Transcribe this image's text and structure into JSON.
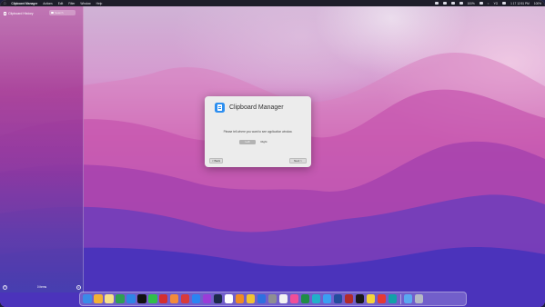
{
  "menubar": {
    "app_name": "Clipboard Manager",
    "items": [
      "Actions",
      "Edit",
      "Filter",
      "Window",
      "Help"
    ],
    "status": {
      "battery": "100%",
      "wifi": "Wi-Fi",
      "lang": "YG",
      "datetime": "1 17 12:51 PM",
      "extra": "100%"
    }
  },
  "sidebar": {
    "title": "Clipboard History",
    "search_placeholder": "Search",
    "item_count": "0 items",
    "left_button": "?",
    "right_button": "+"
  },
  "dialog": {
    "title": "Clipboard Manager",
    "message": "Please tell where you want to see application window.",
    "segment_left": "Left",
    "segment_right": "Right",
    "back_label": "< Back",
    "next_label": "Next >"
  },
  "dock": {
    "apps": [
      {
        "name": "finder",
        "color": "#3a8be8"
      },
      {
        "name": "launchpad",
        "color": "#f2b134"
      },
      {
        "name": "notes",
        "color": "#f6e08a"
      },
      {
        "name": "terminal-green",
        "color": "#2e9f52"
      },
      {
        "name": "safari",
        "color": "#2e84e6"
      },
      {
        "name": "qq",
        "color": "#111111"
      },
      {
        "name": "wechat",
        "color": "#2fbf4a"
      },
      {
        "name": "netease",
        "color": "#d42f2f"
      },
      {
        "name": "photos",
        "color": "#f28a3b"
      },
      {
        "name": "app-red",
        "color": "#d83b3b"
      },
      {
        "name": "app-store",
        "color": "#2b84f2"
      },
      {
        "name": "app-purple",
        "color": "#9b3cd8"
      },
      {
        "name": "photoshop",
        "color": "#1d2a4a"
      },
      {
        "name": "bluetooth",
        "color": "#ffffff"
      },
      {
        "name": "sublime",
        "color": "#ef8b24"
      },
      {
        "name": "chrome",
        "color": "#f1c232"
      },
      {
        "name": "app-blue",
        "color": "#2f6fe0"
      },
      {
        "name": "settings",
        "color": "#8e8e93"
      },
      {
        "name": "pen",
        "color": "#f2f2f2"
      },
      {
        "name": "app-pink",
        "color": "#f04e98"
      },
      {
        "name": "excel",
        "color": "#1f8d46"
      },
      {
        "name": "app-cyan",
        "color": "#21b1c9"
      },
      {
        "name": "cloud",
        "color": "#3aa0f2"
      },
      {
        "name": "app-darkblue",
        "color": "#244c9c"
      },
      {
        "name": "word-red",
        "color": "#b22b2b"
      },
      {
        "name": "terminal",
        "color": "#1a1a1a"
      },
      {
        "name": "qq-music",
        "color": "#f5d43a"
      },
      {
        "name": "app-red2",
        "color": "#e53935"
      },
      {
        "name": "app-teal",
        "color": "#12a1a8"
      },
      {
        "name": "folder",
        "color": "#5aa8f0"
      },
      {
        "name": "trash",
        "color": "#b5b9c5"
      }
    ]
  }
}
